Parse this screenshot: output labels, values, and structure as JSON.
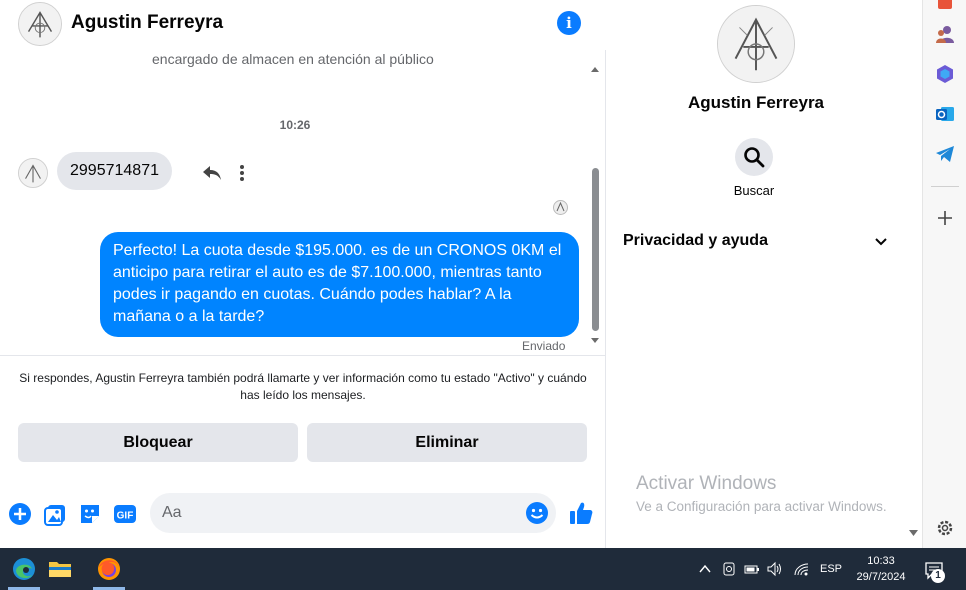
{
  "chat": {
    "contact_name": "Agustin Ferreyra",
    "clipped_previous_text": "encargado de almacen en atención al público",
    "timestamp": "10:26",
    "incoming_message": "2995714871",
    "outgoing_message": "Perfecto! La cuota desde $195.000. es de un CRONOS 0KM el anticipo para retirar el auto es de $7.100.000, mientras tanto podes ir pagando en cuotas. Cuándo podes hablar? A la mañana o a la tarde?",
    "outgoing_status": "Enviado",
    "notice": "Si respondes, Agustin Ferreyra también podrá llamarte y ver información como tu estado \"Activo\" y cuándo has leído los mensajes.",
    "block_label": "Bloquear",
    "delete_label": "Eliminar",
    "composer_placeholder": "Aa",
    "composer_icons": [
      "plus-icon",
      "photo-icon",
      "sticker-icon",
      "gif-icon",
      "emoji-icon",
      "like-icon"
    ]
  },
  "info_panel": {
    "profile_name": "Agustin Ferreyra",
    "search_label": "Buscar",
    "privacy_label": "Privacidad y ayuda"
  },
  "watermark": {
    "title": "Activar Windows",
    "subtitle": "Ve a Configuración para activar Windows."
  },
  "edge_sidebar": {
    "icons": [
      "tools-icon",
      "people-icon",
      "copilot-icon",
      "outlook-icon",
      "telegram-icon",
      "add-icon",
      "settings-icon"
    ]
  },
  "taskbar": {
    "apps": [
      "edge-icon",
      "file-explorer-icon",
      "firefox-icon"
    ],
    "language": "ESP",
    "time": "10:33",
    "date": "29/7/2024",
    "notification_count": "1"
  },
  "colors": {
    "messenger_blue": "#0084ff",
    "info_blue": "#0a7cff",
    "bubble_gray": "#e4e6eb",
    "taskbar_bg": "#1f2b3a"
  }
}
